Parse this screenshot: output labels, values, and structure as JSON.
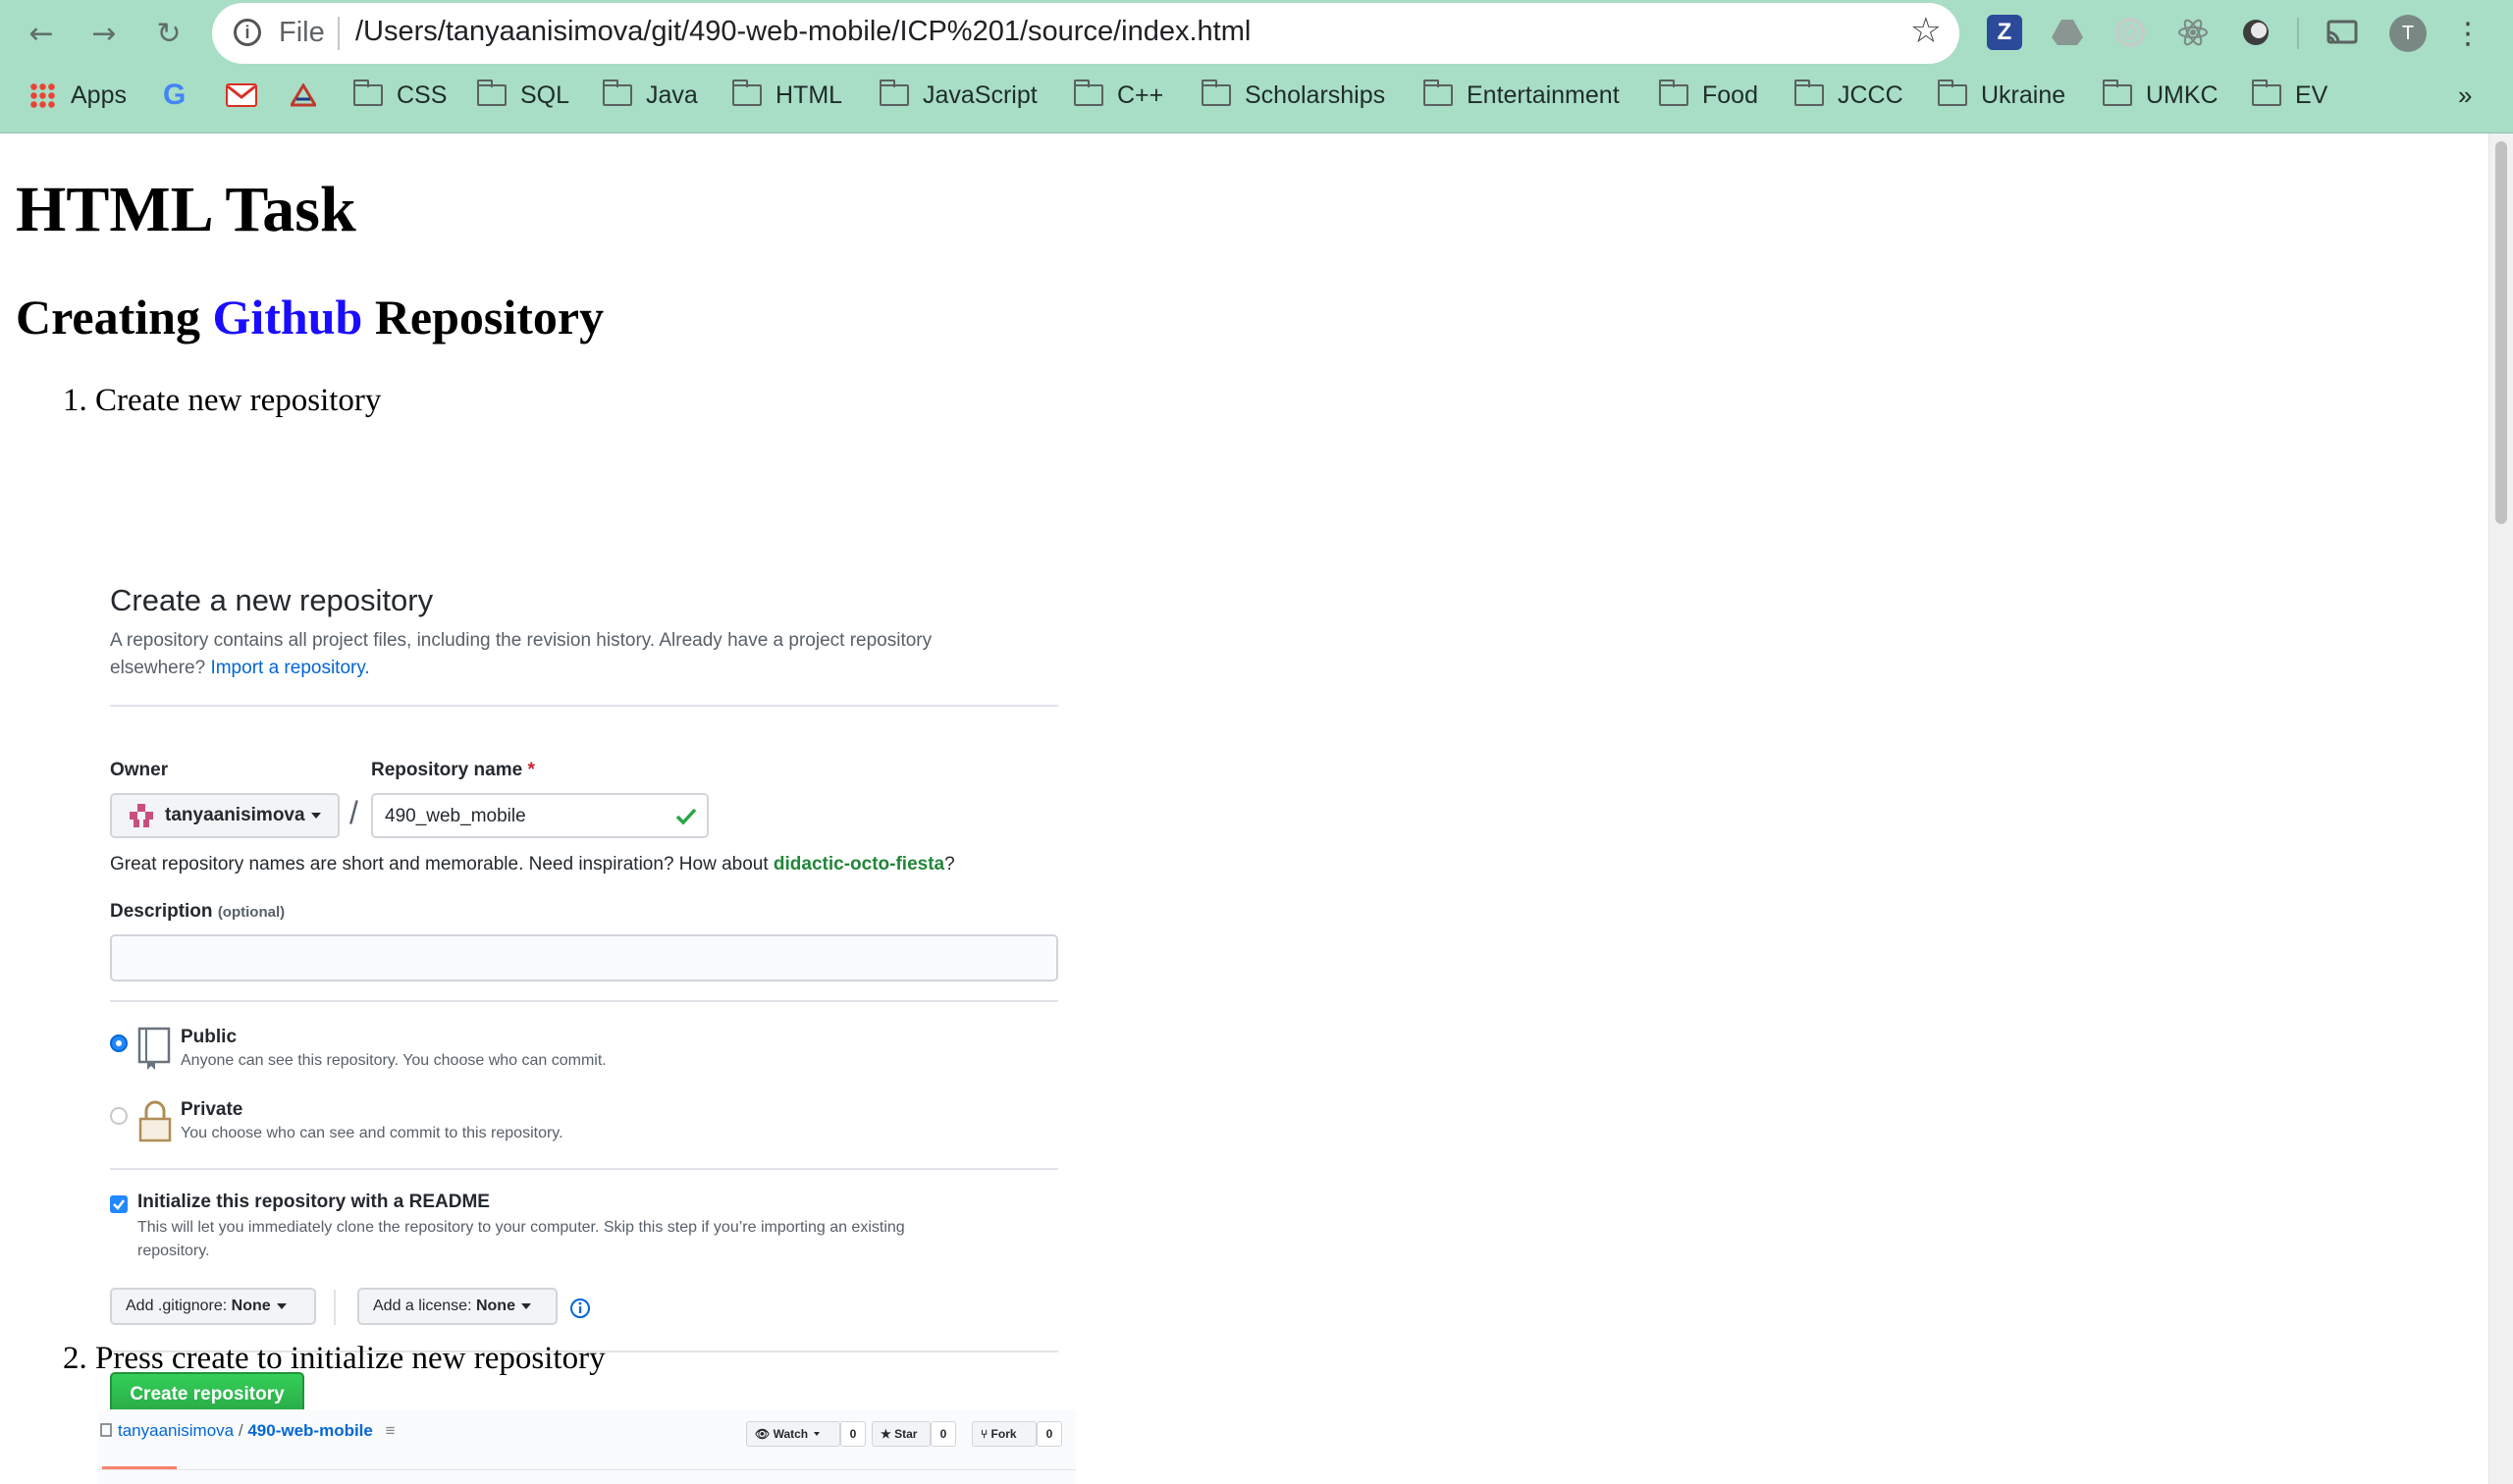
{
  "browser": {
    "file_label": "File",
    "url": "/Users/tanyaanisimova/git/490-web-mobile/ICP%201/source/index.html",
    "profile_initial": "T",
    "bookmarks": [
      {
        "label": "Apps",
        "icon": "apps-grid-icon"
      },
      {
        "label": "",
        "icon": "google-icon"
      },
      {
        "label": "",
        "icon": "gmail-icon"
      },
      {
        "label": "",
        "icon": "triangle-logo-icon"
      },
      {
        "label": "CSS",
        "icon": "folder-icon"
      },
      {
        "label": "SQL",
        "icon": "folder-icon"
      },
      {
        "label": "Java",
        "icon": "folder-icon"
      },
      {
        "label": "HTML",
        "icon": "folder-icon"
      },
      {
        "label": "JavaScript",
        "icon": "folder-icon"
      },
      {
        "label": "C++",
        "icon": "folder-icon"
      },
      {
        "label": "Scholarships",
        "icon": "folder-icon"
      },
      {
        "label": "Entertainment",
        "icon": "folder-icon"
      },
      {
        "label": "Food",
        "icon": "folder-icon"
      },
      {
        "label": "JCCC",
        "icon": "folder-icon"
      },
      {
        "label": "Ukraine",
        "icon": "folder-icon"
      },
      {
        "label": "UMKC",
        "icon": "folder-icon"
      },
      {
        "label": "EV",
        "icon": "folder-icon"
      }
    ],
    "overflow": "»"
  },
  "page": {
    "title": "HTML Task",
    "subtitle_pre": "Creating ",
    "subtitle_link": "Github",
    "subtitle_post": " Repository",
    "step1": "1. Create new repository",
    "step2": "2. Press create to initialize new repository"
  },
  "github_form": {
    "heading": "Create a new repository",
    "intro_line1": "A repository contains all project files, including the revision history. Already have a project repository",
    "intro_line2": "elsewhere?",
    "import_link": "Import a repository.",
    "owner_label": "Owner",
    "repo_label": "Repository name",
    "required_mark": "*",
    "owner_value": "tanyaanisimova",
    "slash": "/",
    "repo_value": "490_web_mobile",
    "hint_text": "Great repository names are short and memorable. Need inspiration? How about",
    "suggestion": "didactic-octo-fiesta",
    "hint_end": "?",
    "description_label": "Description",
    "description_optional": "(optional)",
    "description_value": "",
    "public_label": "Public",
    "public_desc": "Anyone can see this repository. You choose who can commit.",
    "private_label": "Private",
    "private_desc": "You choose who can see and commit to this repository.",
    "readme_label": "Initialize this repository with a README",
    "readme_desc1": "This will let you immediately clone the repository to your computer. Skip this step if you’re importing an existing",
    "readme_desc2": "repository.",
    "gitignore_prefix": "Add .gitignore:",
    "gitignore_value": "None",
    "license_prefix": "Add a license:",
    "license_value": "None",
    "create_button": "Create repository",
    "visibility_selected": "Public",
    "readme_checked": true
  },
  "repo_screenshot": {
    "owner": "tanyaanisimova",
    "separator": "/",
    "repo": "490-web-mobile",
    "watch_label": "Watch",
    "watch_count": "0",
    "star_label": "Star",
    "star_count": "0",
    "fork_label": "Fork",
    "fork_count": "0"
  },
  "colors": {
    "chrome_bg": "#a8ddc6",
    "link_blue": "#0366d6",
    "github_link": "#1a0dff",
    "create_green": "#28a745",
    "suggestion_green": "#22863a",
    "required_red": "#cb2431"
  }
}
